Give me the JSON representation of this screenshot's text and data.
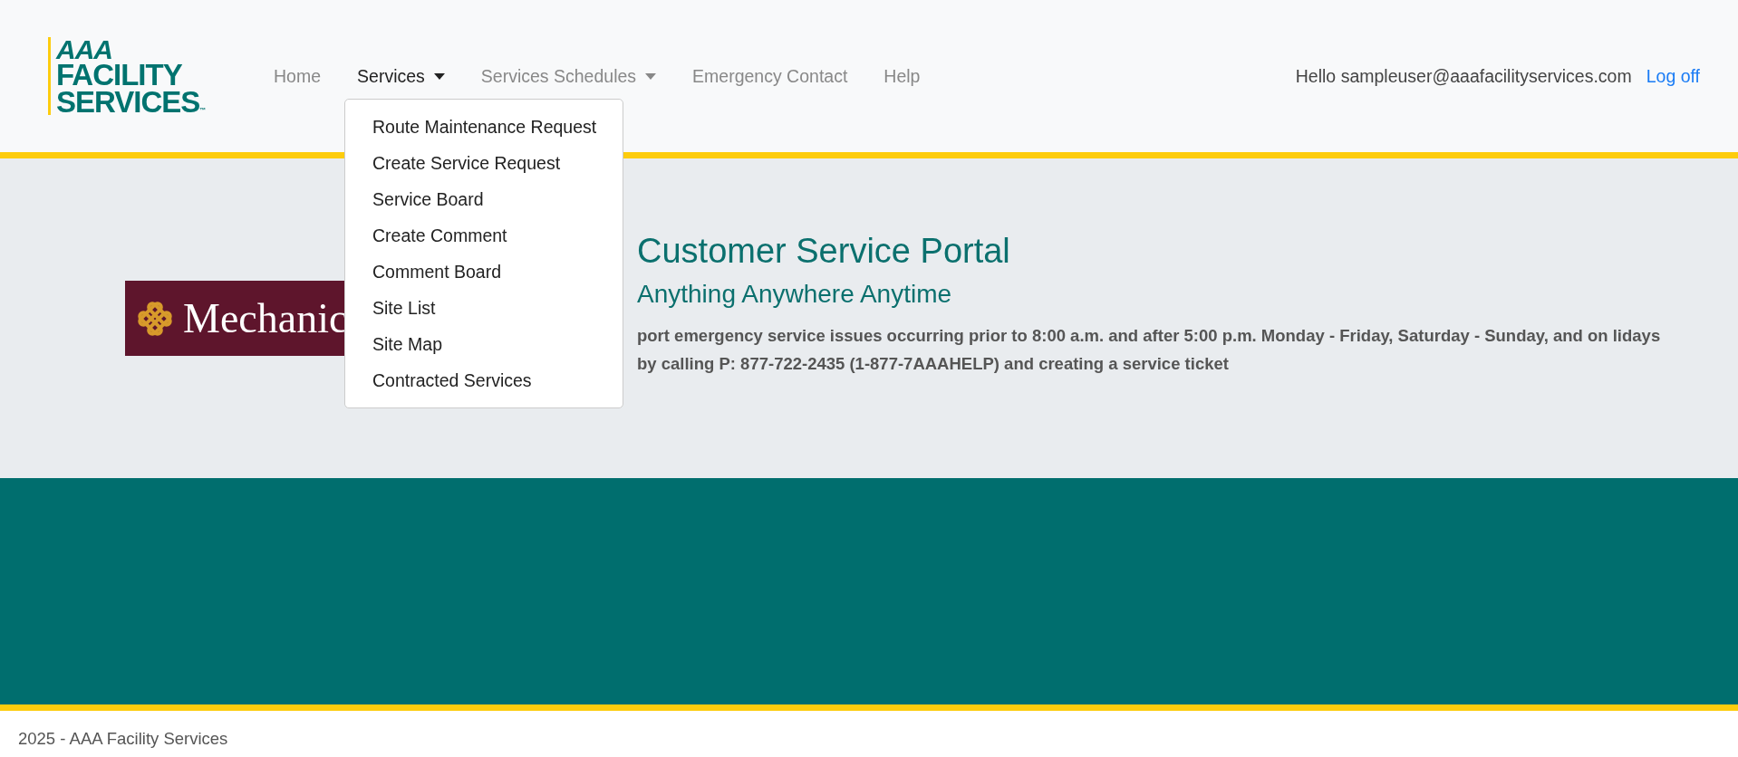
{
  "logo": {
    "line_1": "AAA",
    "line_2": "FACILITY",
    "line_3": "SERVICES",
    "mark": "™"
  },
  "nav": [
    {
      "label": "Home",
      "selected": false,
      "dropdown": false
    },
    {
      "label": "Services",
      "selected": true,
      "dropdown": true
    },
    {
      "label": "Services Schedules",
      "selected": false,
      "dropdown": true
    },
    {
      "label": "Emergency Contact",
      "selected": false,
      "dropdown": false
    },
    {
      "label": "Help",
      "selected": false,
      "dropdown": false
    }
  ],
  "user": {
    "greeting": "Hello sampleuser@aaafacilityservices.com",
    "logoff": "Log off"
  },
  "services_menu": [
    "Route Maintenance Request",
    "Create Service Request",
    "Service Board",
    "Create Comment",
    "Comment Board",
    "Site List",
    "Site Map",
    "Contracted Services"
  ],
  "client_logo": {
    "text": "Mechanic"
  },
  "hero": {
    "title": "Customer Service Portal",
    "subtitle": "Anything Anywhere Anytime",
    "notice": "port emergency service issues occurring prior to 8:00 a.m. and after 5:00 p.m. Monday - Friday, Saturday - Sunday, and on lidays by calling P: 877-722-2435 (1-877-7AAAHELP) and creating a service ticket"
  },
  "footer": {
    "text": "2025 - AAA Facility Services"
  }
}
